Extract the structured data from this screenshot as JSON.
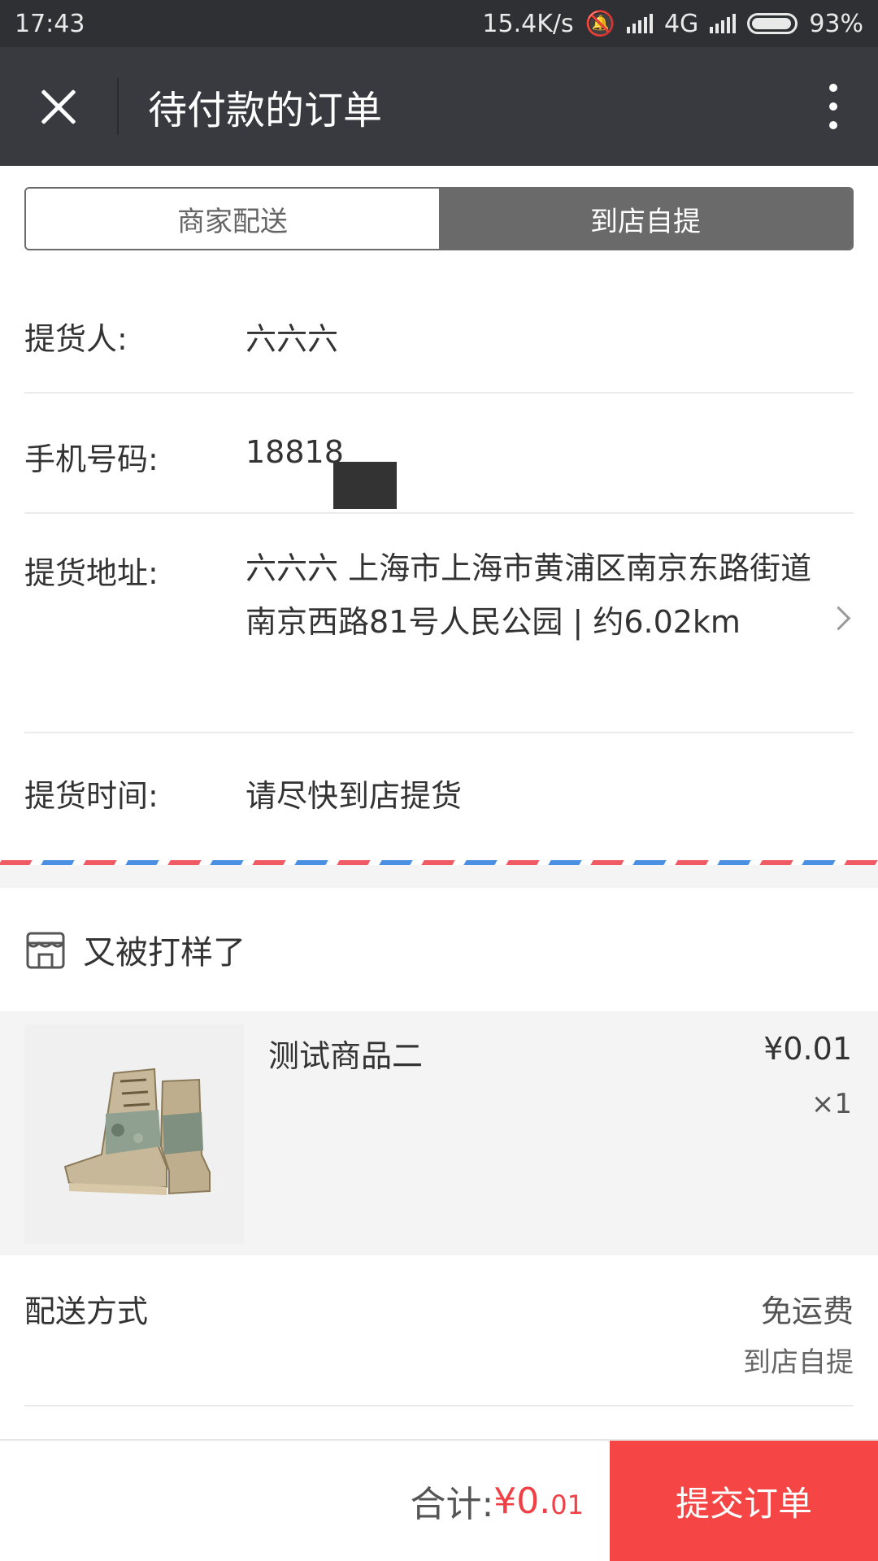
{
  "status_bar": {
    "time": "17:43",
    "network_speed": "15.4K/s",
    "network_type": "4G",
    "battery": "93%"
  },
  "header": {
    "title": "待付款的订单"
  },
  "delivery_toggle": {
    "merchant_label": "商家配送",
    "pickup_label": "到店自提",
    "selected": "到店自提"
  },
  "pickup_info": {
    "person_label": "提货人:",
    "person_value": "六六六",
    "phone_label": "手机号码:",
    "phone_value": "18818",
    "address_label": "提货地址:",
    "address_value": "六六六 上海市上海市黄浦区南京东路街道南京西路81号人民公园 | 约6.02km",
    "time_label": "提货时间:",
    "time_value": "请尽快到店提货"
  },
  "shop": {
    "name": "又被打样了"
  },
  "product": {
    "name": "测试商品二",
    "price": "¥0.01",
    "quantity": "×1"
  },
  "delivery_method": {
    "label": "配送方式",
    "fee": "免运费",
    "type": "到店自提"
  },
  "footer": {
    "total_label": "合计:",
    "total_amount": "¥0.",
    "total_cents": "01",
    "submit_label": "提交订单"
  },
  "colors": {
    "status_bar_bg": "#2f3033",
    "title_bar_bg": "#393a3f",
    "accent_red": "#f54545",
    "toggle_active": "#6a6a6a"
  }
}
